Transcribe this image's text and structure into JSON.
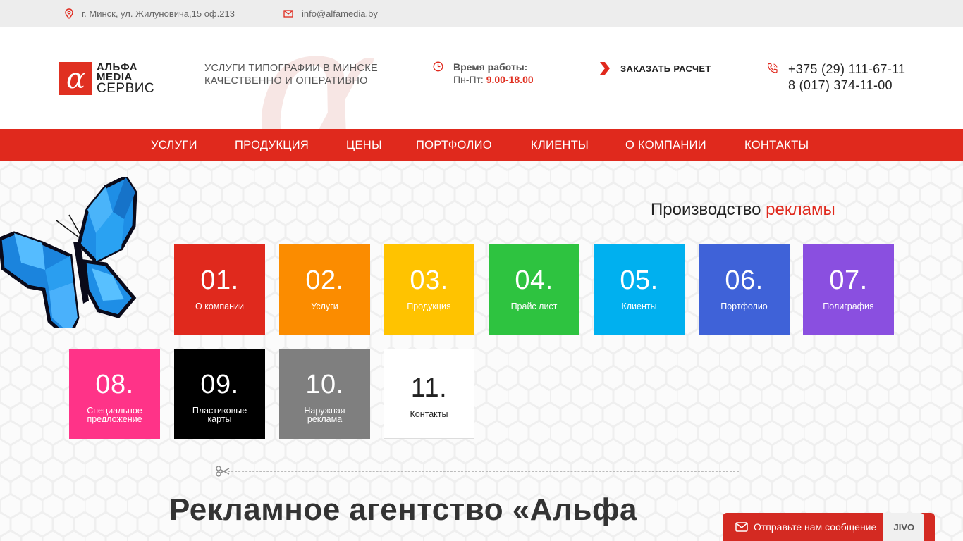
{
  "topbar": {
    "address": "г. Минск, ул. Жилуновича,15 оф.213",
    "email": "info@alfamedia.by",
    "address_icon": "map-pin-icon",
    "email_icon": "envelope-icon"
  },
  "logo": {
    "line1": "АЛЬФА",
    "line2": "MEDIA",
    "line3": "СЕРВИС"
  },
  "tagline": {
    "line1": "УСЛУГИ ТИПОГРАФИИ В МИНСКЕ",
    "line2": "КАЧЕСТВЕННО И ОПЕРАТИВНО"
  },
  "hours": {
    "label": "Время работы:",
    "days": "Пн-Пт: ",
    "time": "9.00-18.00"
  },
  "order": {
    "label": "ЗАКАЗАТЬ РАСЧЕТ"
  },
  "phones": {
    "phone1": "+375 (29) 111-67-11",
    "phone2": "8 (017) 374-11-00"
  },
  "nav": {
    "items": [
      {
        "label": "УСЛУГИ"
      },
      {
        "label": "ПРОДУКЦИЯ"
      },
      {
        "label": "ЦЕНЫ"
      },
      {
        "label": "ПОРТФОЛИО"
      },
      {
        "label": "КЛИЕНТЫ"
      },
      {
        "label": "О КОМПАНИИ"
      },
      {
        "label": "КОНТАКТЫ"
      }
    ]
  },
  "production": {
    "title_main": "Производство ",
    "title_accent": "рекламы"
  },
  "tiles": [
    {
      "num": "01.",
      "label": "О компании",
      "color": "#e0291d"
    },
    {
      "num": "02.",
      "label": "Услуги",
      "color": "#fb8c00"
    },
    {
      "num": "03.",
      "label": "Продукция",
      "color": "#ffc300"
    },
    {
      "num": "04.",
      "label": "Прайс лист",
      "color": "#2ec340"
    },
    {
      "num": "05.",
      "label": "Клиенты",
      "color": "#00b0ef"
    },
    {
      "num": "06.",
      "label": "Портфолио",
      "color": "#3f62d8"
    },
    {
      "num": "07.",
      "label": "Полиграфия",
      "color": "#8a4fe0"
    },
    {
      "num": "08.",
      "label": "Специальное предложение",
      "color": "#ff3388"
    },
    {
      "num": "09.",
      "label": "Пластиковые карты",
      "color": "#000000"
    },
    {
      "num": "10.",
      "label": "Наружная реклама",
      "color": "#7f7f7f"
    },
    {
      "num": "11.",
      "label": "Контакты",
      "color": "#ffffff"
    }
  ],
  "headline": "Рекламное агентство «Альфа",
  "chat": {
    "label": "Отправьте нам сообщение",
    "brand": "JIVO"
  },
  "colors": {
    "accent": "#e0291d",
    "topbar_bg": "#ededed"
  }
}
